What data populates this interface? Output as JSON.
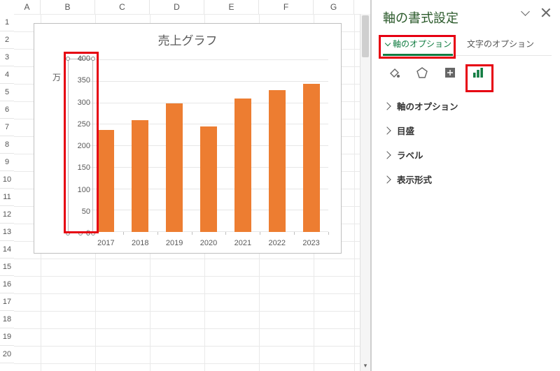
{
  "columns": [
    "A",
    "B",
    "C",
    "D",
    "E",
    "F",
    "G"
  ],
  "rows": [
    "1",
    "2",
    "3",
    "4",
    "5",
    "6",
    "7",
    "8",
    "9",
    "10",
    "11",
    "12",
    "13",
    "14",
    "15",
    "16",
    "17",
    "18",
    "19",
    "20"
  ],
  "chart": {
    "title": "売上グラフ",
    "unit_label": "万"
  },
  "chart_data": {
    "type": "bar",
    "title": "売上グラフ",
    "categories": [
      "2017",
      "2018",
      "2019",
      "2020",
      "2021",
      "2022",
      "2023"
    ],
    "values": [
      238,
      260,
      300,
      245,
      310,
      330,
      345
    ],
    "xlabel": "",
    "ylabel": "万",
    "ylim": [
      0,
      400
    ],
    "y_ticks": [
      0,
      50,
      100,
      150,
      200,
      250,
      300,
      350,
      400
    ],
    "grid": true,
    "legend": false
  },
  "pane": {
    "title": "軸の書式設定",
    "tabs": {
      "axis": "軸のオプション",
      "text": "文字のオプション"
    },
    "sections": {
      "axis_options": "軸のオプション",
      "tick": "目盛",
      "label": "ラベル",
      "number": "表示形式"
    },
    "icons": {
      "fill": "fill-bucket-icon",
      "effects": "pentagon-icon",
      "size": "size-props-icon",
      "chart": "bar-chart-icon"
    }
  }
}
